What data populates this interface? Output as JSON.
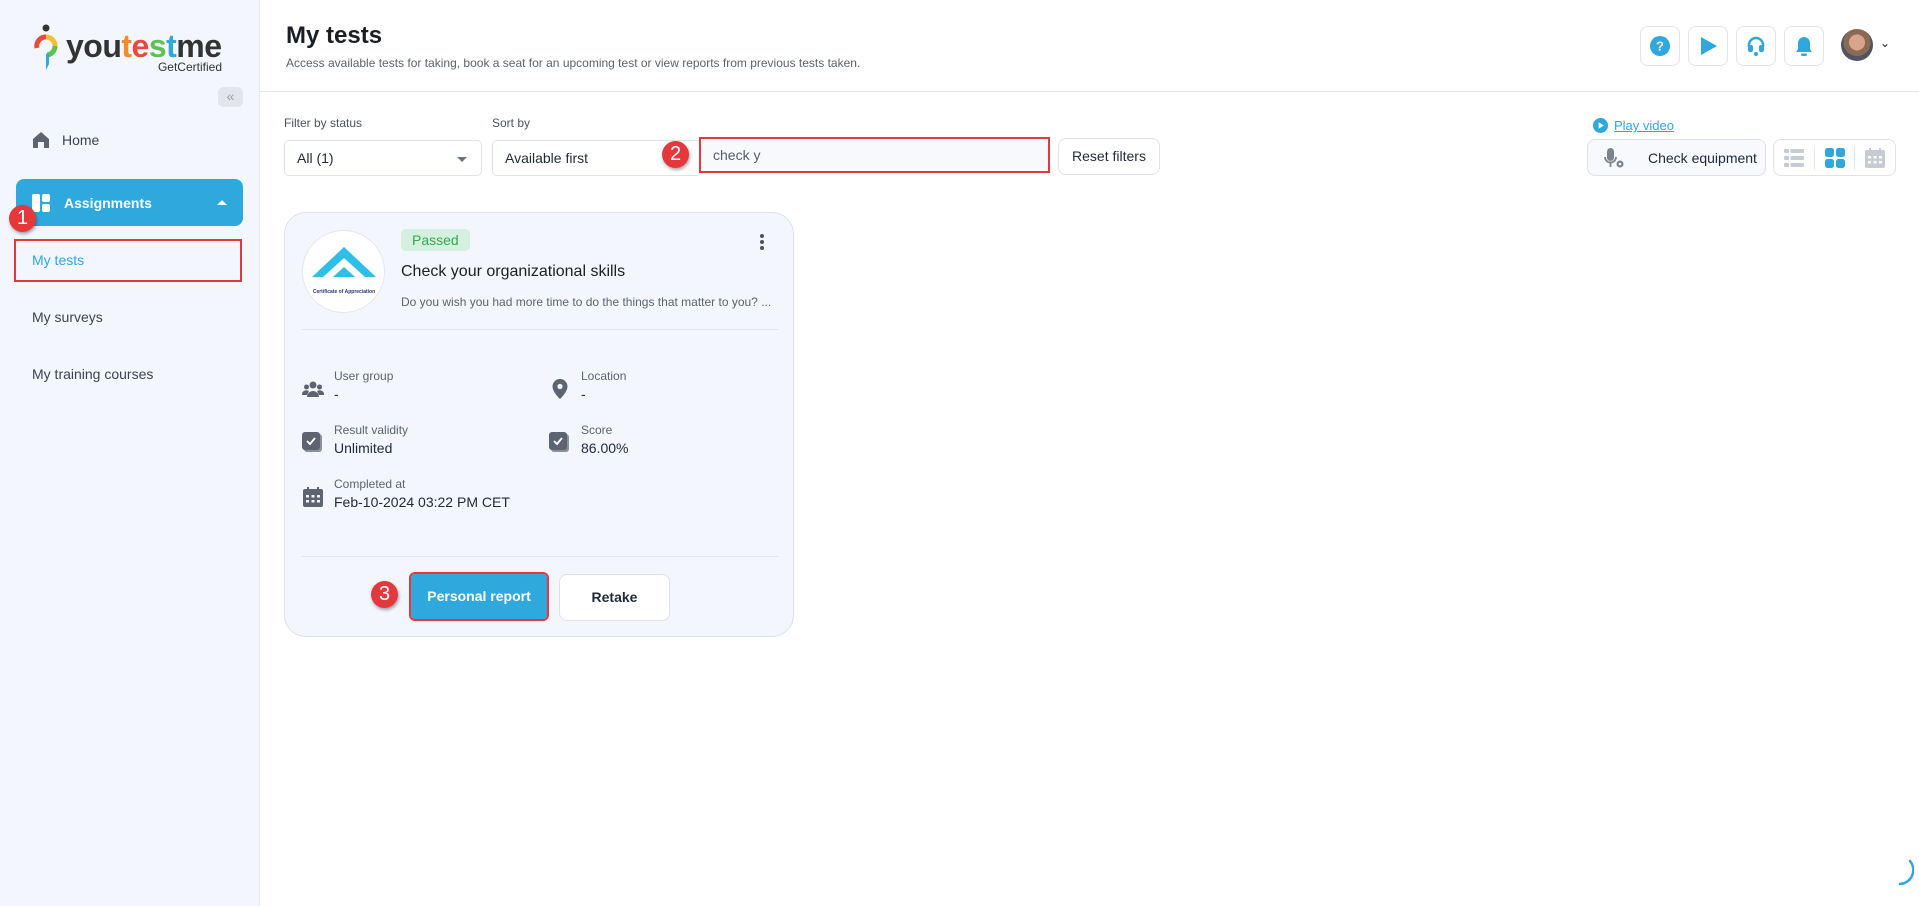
{
  "brand": {
    "name_parts": [
      "you",
      "t",
      "e",
      "s",
      "t",
      "me"
    ],
    "subtitle": "GetCertified",
    "accent": "#2fa8dd"
  },
  "sidebar": {
    "collapse_icon": "double-chevron-left-icon",
    "home": {
      "label": "Home",
      "icon": "home-icon"
    },
    "assignments": {
      "label": "Assignments",
      "icon": "dashboard-icon",
      "expanded": true
    },
    "sub_items": [
      {
        "label": "My tests",
        "active": true
      },
      {
        "label": "My surveys",
        "active": false
      },
      {
        "label": "My training courses",
        "active": false
      }
    ]
  },
  "header": {
    "title": "My tests",
    "subtitle": "Access available tests for taking, book a seat for an upcoming test or view reports from previous tests taken.",
    "buttons": [
      "help-icon",
      "play-icon",
      "headset-icon",
      "bell-icon"
    ]
  },
  "filters": {
    "status_label": "Filter by status",
    "status_value": "All (1)",
    "sort_label": "Sort by",
    "sort_value": "Available first",
    "search_value": "check y",
    "reset_label": "Reset filters",
    "play_video_label": "Play video",
    "check_equipment_label": "Check equipment",
    "view_modes": [
      "list",
      "grid",
      "calendar"
    ],
    "active_view": "grid"
  },
  "steps": [
    "1",
    "2",
    "3"
  ],
  "card": {
    "status": "Passed",
    "title": "Check your organizational skills",
    "description": "Do you wish you had more time to do the things that matter to you? ...",
    "certificate_text": "Certificate of Appreciation",
    "meta": {
      "user_group_label": "User group",
      "user_group_value": "-",
      "location_label": "Location",
      "location_value": "-",
      "validity_label": "Result validity",
      "validity_value": "Unlimited",
      "score_label": "Score",
      "score_value": "86.00%",
      "completed_label": "Completed at",
      "completed_value": "Feb-10-2024 03:22 PM CET"
    },
    "primary_button": "Personal report",
    "secondary_button": "Retake"
  }
}
